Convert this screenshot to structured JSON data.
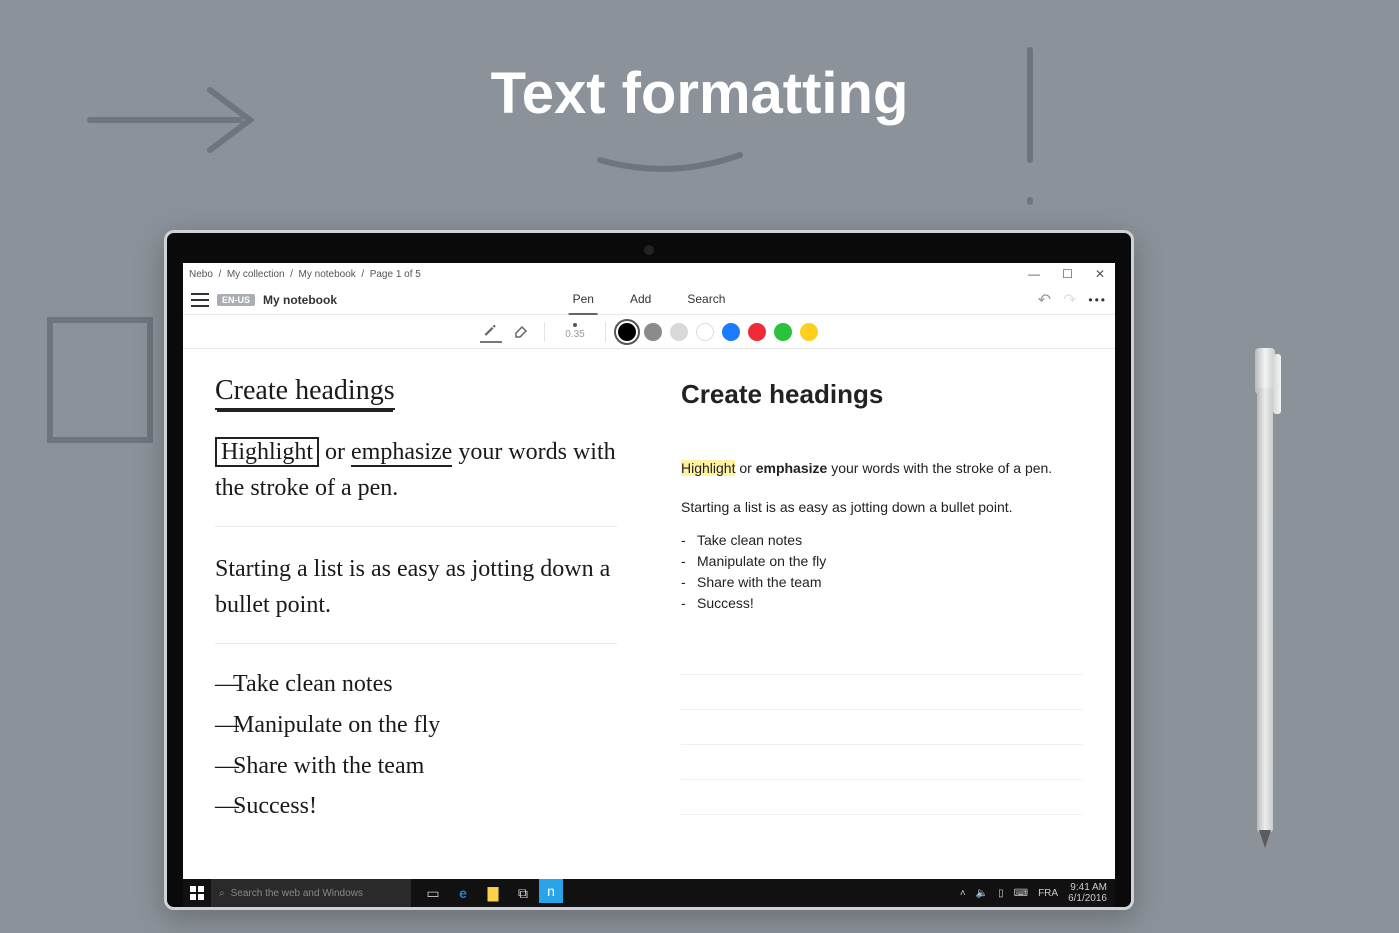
{
  "promo": {
    "title": "Text formatting"
  },
  "breadcrumb": [
    "Nebo",
    "My collection",
    "My notebook",
    "Page 1 of 5"
  ],
  "toolbar": {
    "lang": "EN-US",
    "notebook": "My notebook",
    "tabs": {
      "pen": "Pen",
      "add": "Add",
      "search": "Search"
    },
    "more": "•••"
  },
  "penbar": {
    "size_label": "0.35",
    "colors": [
      "#000000",
      "#8b8b8b",
      "#d9d9d9",
      "#ffffff",
      "#1d7bff",
      "#ef2b3a",
      "#29c23a",
      "#ffcf1d"
    ]
  },
  "handwritten": {
    "heading": "Create headings",
    "p1_highlight": "Highlight",
    "p1_mid": " or ",
    "p1_emph": "emphasize",
    "p1_tail": " your words with the stroke of a pen.",
    "p2": "Starting a list is as easy as jotting down a bullet point.",
    "list": [
      "Take clean notes",
      "Manipulate on the fly",
      "Share with the team",
      "Success!"
    ]
  },
  "rendered": {
    "heading": "Create headings",
    "p1_highlight": "Highlight",
    "p1_mid": " or ",
    "p1_emph": "emphasize",
    "p1_tail": " your words with the stroke of a pen.",
    "p2": "Starting a list is as easy as jotting down a bullet point.",
    "list": [
      "Take clean notes",
      "Manipulate on the fly",
      "Share with the team",
      "Success!"
    ]
  },
  "taskbar": {
    "search_placeholder": "Search the web and Windows",
    "lang": "FRA",
    "time": "9:41 AM",
    "date": "6/1/2016"
  }
}
